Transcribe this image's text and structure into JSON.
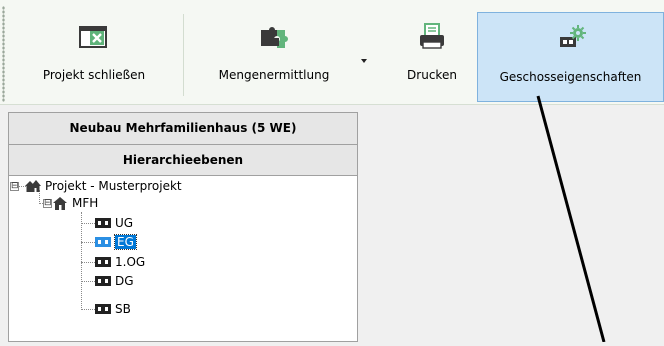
{
  "ribbon": {
    "buttons": [
      {
        "label": "Projekt schließen",
        "icon": "close-project-icon"
      },
      {
        "label": "Mengenermittlung",
        "icon": "puzzle-icon"
      },
      {
        "label": "Drucken",
        "icon": "printer-icon"
      },
      {
        "label": "Geschosseigenschaften",
        "icon": "floor-settings-icon"
      }
    ],
    "colors": {
      "background": "#f5f8f3",
      "active": "#cce4f7",
      "active_border": "#7fb2de",
      "accent_green": "#62b57c"
    }
  },
  "panel": {
    "project_title": "Neubau Mehrfamilienhaus (5 WE)",
    "hierarchy_header": "Hierarchieebenen"
  },
  "tree": {
    "root": {
      "label": "Projekt - Musterprojekt",
      "expander": "⊟"
    },
    "building": {
      "label": "MFH",
      "expander": "⊟"
    },
    "floors": [
      {
        "label": "UG",
        "selected": false
      },
      {
        "label": "EG",
        "selected": true
      },
      {
        "label": "1.OG",
        "selected": false
      },
      {
        "label": "DG",
        "selected": false
      },
      {
        "label": "SB",
        "selected": false
      }
    ],
    "selection_color": "#0078d7"
  }
}
